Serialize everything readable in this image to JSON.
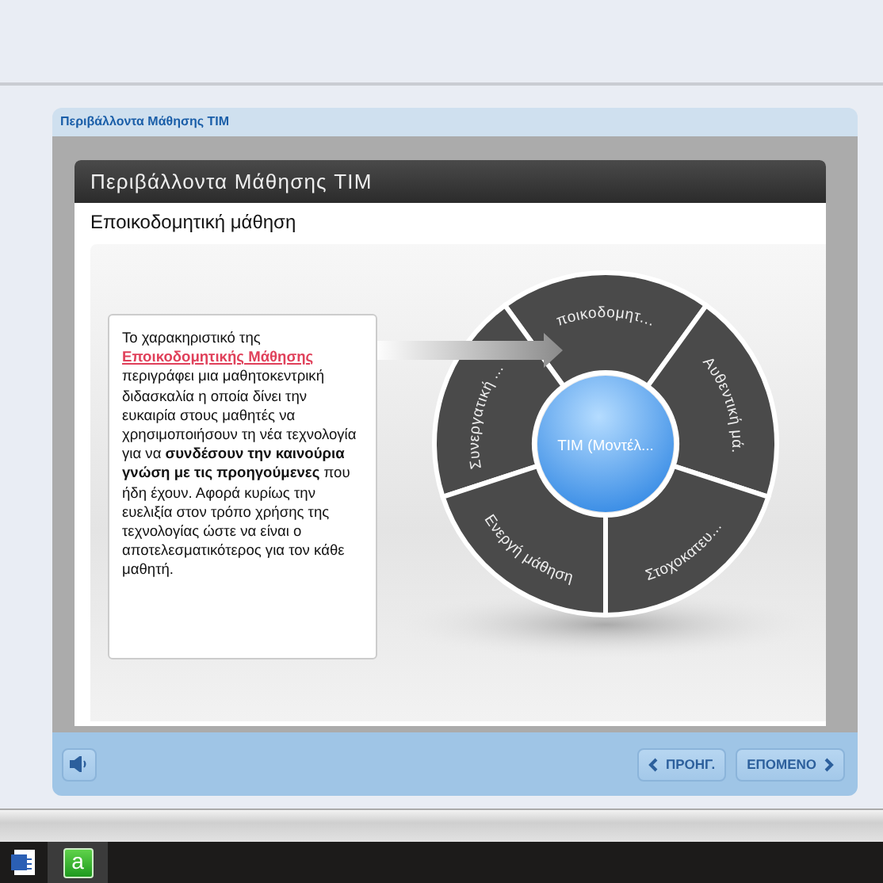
{
  "player": {
    "title": "Περιβάλλοντα Μάθησης TIM"
  },
  "slide": {
    "header": "Περιβάλλοντα Μάθησης TIM",
    "subtitle": "Εποικοδομητική μάθηση",
    "callout": {
      "lead": "Το χαρακηριστικό της",
      "link": "Εποικοδομητικής Μάθησης",
      "body": "περιγράφει μια μαθητοκεντρική διδασκαλία η οποία δίνει την ευκαιρία στους μαθητές να χρησιμοποιήσουν τη νέα τεχνολογία για να **συνδέσουν την καινούρια γνώση με τις προηγούμενες** που ήδη έχουν. Αφορά κυρίως την ευελιξία στον τρόπο χρήσης της τεχνολογίας ώστε να είναι ο αποτελεσματικότερος για τον κάθε μαθητή."
    },
    "wheel": {
      "center": "TIM (Μοντέλ...",
      "segments": [
        "ποικοδομητ...",
        "Συνεργατική ...",
        "Αυθεντική μά.",
        "Ενεργή μάθηση",
        "Στοχοκατευ..."
      ]
    }
  },
  "controls": {
    "buttons": [
      {
        "label": "ΠΡΟΗΓ.",
        "kind": "prev"
      },
      {
        "label": "ΕΠΟΜΕΝΟ",
        "kind": "next"
      }
    ]
  },
  "taskbar": {
    "apps": [
      {
        "kind": "document",
        "selected": false
      },
      {
        "kind": "green",
        "glyph": "a",
        "selected": true
      }
    ]
  }
}
